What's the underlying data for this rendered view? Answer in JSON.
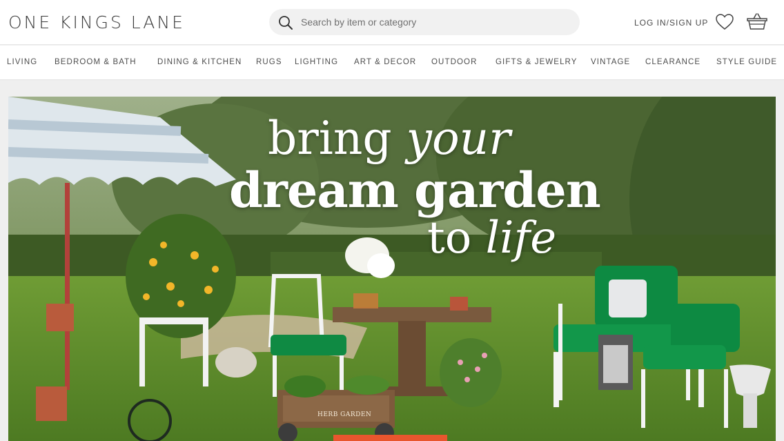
{
  "header": {
    "logo": "ONE KINGS LANE",
    "search_placeholder": "Search by item or category",
    "login_label": "LOG IN/SIGN UP",
    "icons": [
      "search-icon",
      "heart-icon",
      "basket-icon"
    ]
  },
  "nav": {
    "items": [
      {
        "label": "LIVING"
      },
      {
        "label": "BEDROOM & BATH"
      },
      {
        "label": "DINING & KITCHEN"
      },
      {
        "label": "RUGS"
      },
      {
        "label": "LIGHTING"
      },
      {
        "label": "ART & DECOR"
      },
      {
        "label": "OUTDOOR"
      },
      {
        "label": "GIFTS & JEWELRY"
      },
      {
        "label": "VINTAGE"
      },
      {
        "label": "CLEARANCE"
      },
      {
        "label": "STYLE GUIDE"
      }
    ]
  },
  "hero": {
    "line1_a": "bring ",
    "line1_b": "your",
    "line2": "dream garden",
    "line3_a": "to ",
    "line3_b": "life",
    "cart_sign": "HERB GARDEN",
    "cta_color": "#e8562e"
  },
  "colors": {
    "text": "#4d4d4d",
    "search_bg": "#f1f1f1",
    "page_bg": "#efefef",
    "grass": "#5f8f2e"
  }
}
